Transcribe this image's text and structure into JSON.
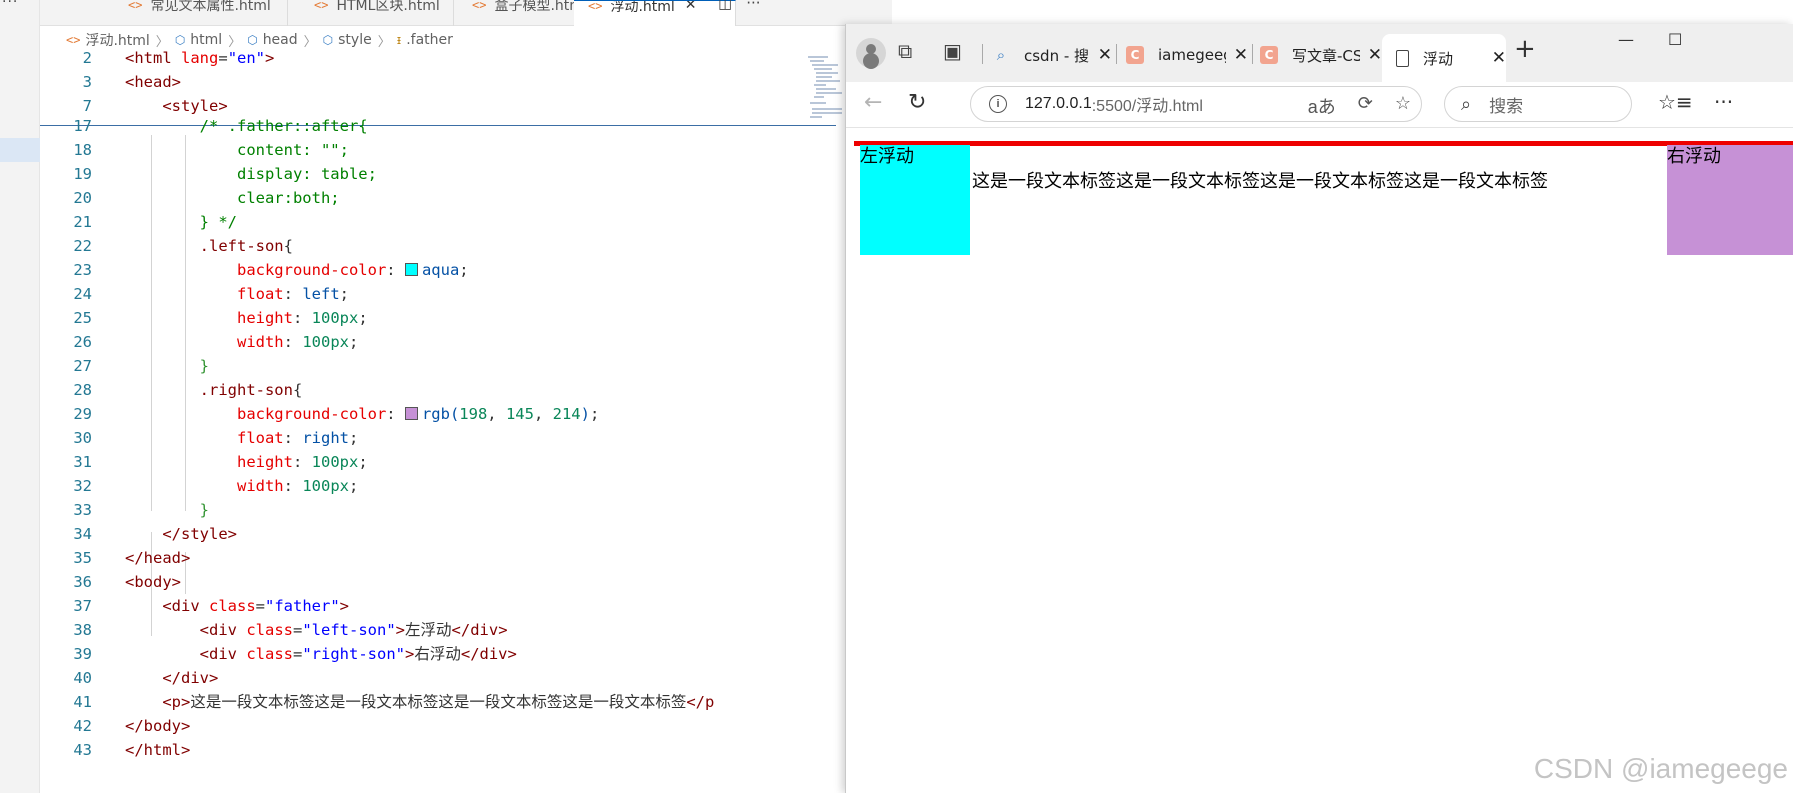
{
  "vscode": {
    "tabs": [
      {
        "label": "常见文本属性.html",
        "active": false
      },
      {
        "label": "HTML区块.html",
        "active": false
      },
      {
        "label": "盒子模型.html",
        "active": false
      },
      {
        "label": "浮动.html",
        "active": true
      }
    ],
    "breadcrumb": [
      "浮动.html",
      "html",
      "head",
      "style",
      ".father"
    ]
  },
  "browser": {
    "tabs": [
      {
        "label": "csdn - 搜索",
        "favicon": "search-icon"
      },
      {
        "label": "iamegeege",
        "favicon": "csdn-icon"
      },
      {
        "label": "写文章-CSDN",
        "favicon": "csdn-icon"
      },
      {
        "label": "浮动",
        "favicon": "page-icon",
        "active": true
      }
    ],
    "address": {
      "host": "127.0.0.1",
      "path": ":5500/浮动.html"
    },
    "search_placeholder": "搜索",
    "page": {
      "left_son": "左浮动",
      "right_son": "右浮动",
      "paragraph": "这是一段文本标签这是一段文本标签这是一段文本标签这是一段文本标签"
    },
    "watermark": "CSDN @iamegeege"
  },
  "colors": {
    "aqua": "#00ffff",
    "right_son": "#c691d6",
    "father_border": "#ee0000"
  }
}
